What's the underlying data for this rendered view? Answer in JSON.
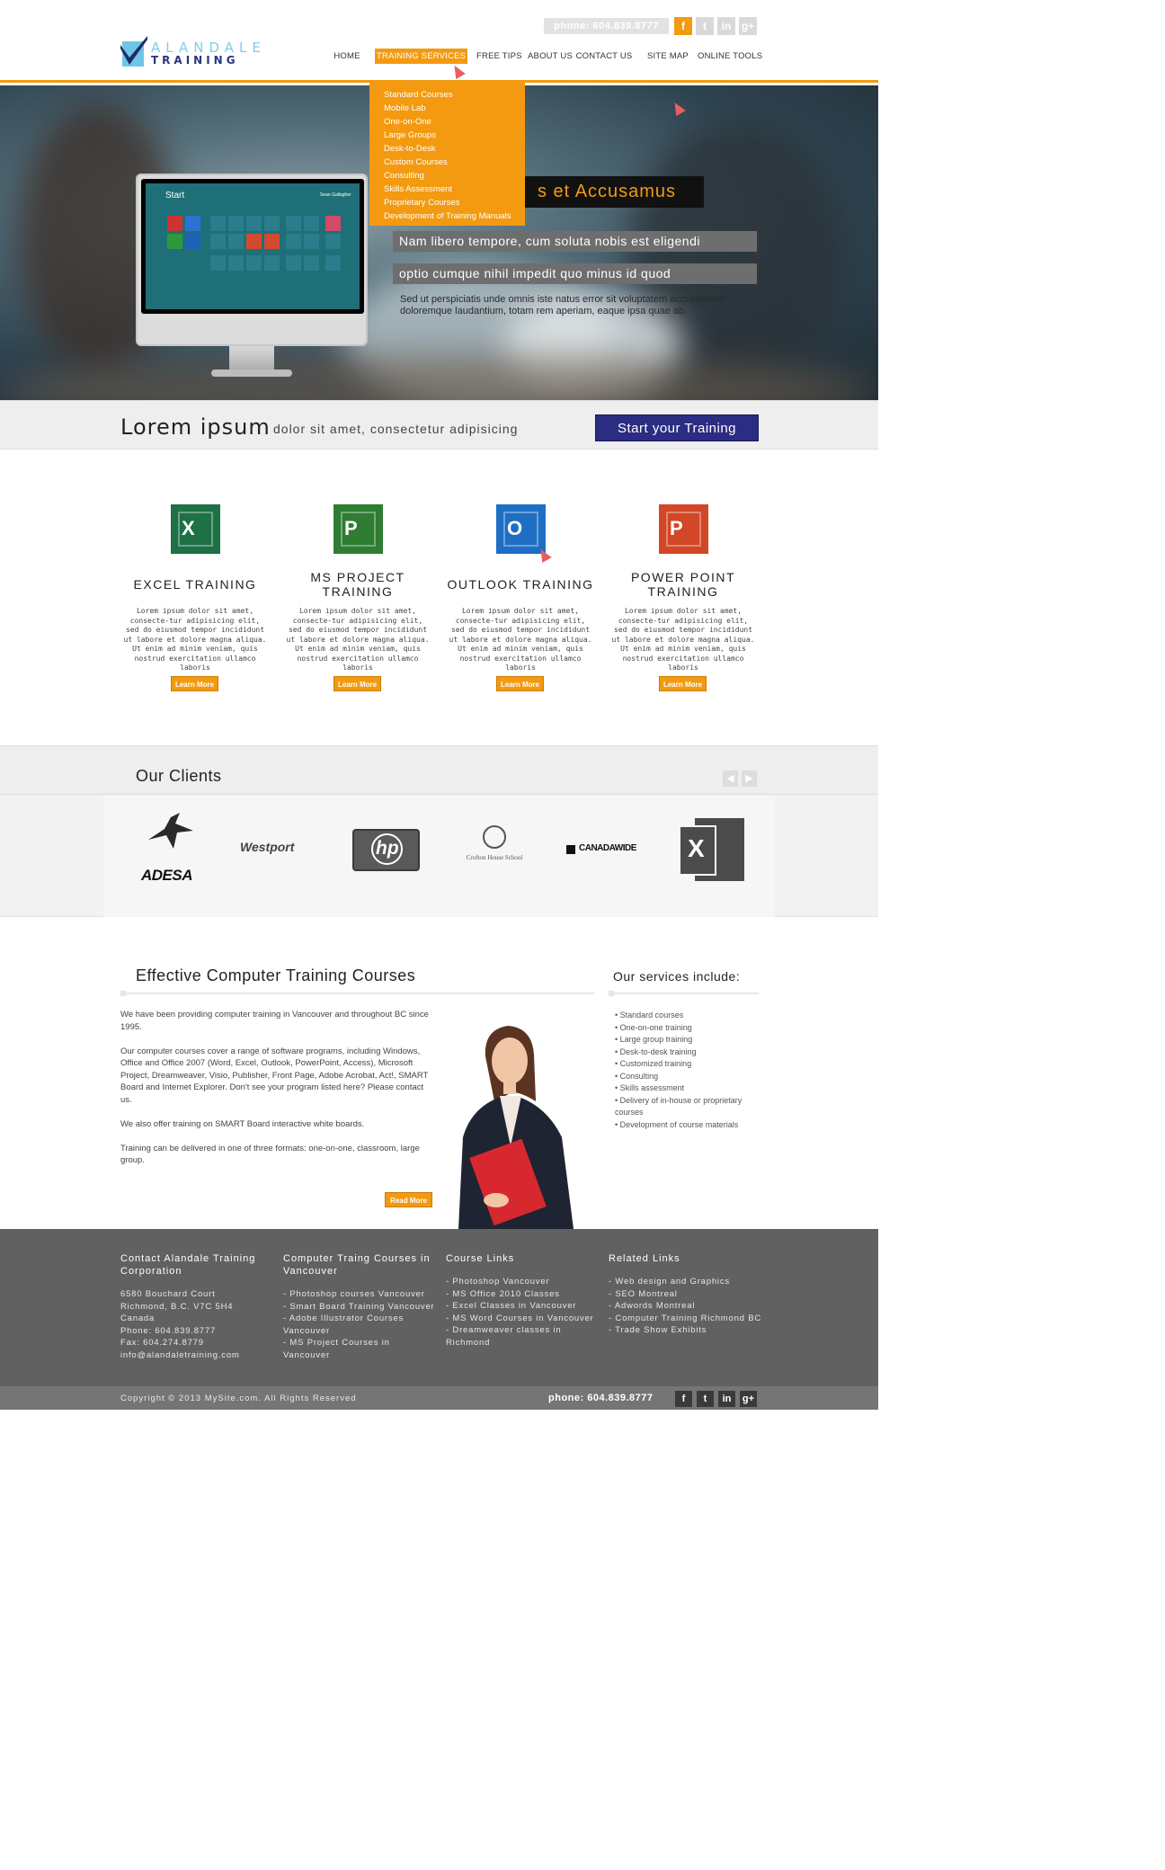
{
  "header": {
    "logo_top": "ALANDALE",
    "logo_bottom": "TRAINING",
    "phone": "phone: 604.839.8777",
    "social": [
      {
        "icon": "facebook-icon",
        "glyph": "f",
        "color": "#f39a11"
      },
      {
        "icon": "twitter-icon",
        "glyph": "t",
        "color": "#d9d9d9"
      },
      {
        "icon": "linkedin-icon",
        "glyph": "in",
        "color": "#d9d9d9"
      },
      {
        "icon": "googleplus-icon",
        "glyph": "g+",
        "color": "#d9d9d9"
      }
    ],
    "nav": [
      "HOME",
      "TRAINING SERVICES",
      "FREE TIPS",
      "ABOUT US",
      "CONTACT US",
      "SITE MAP",
      "ONLINE TOOLS"
    ],
    "dropdown": [
      "Standard Courses",
      "Mobile Lab",
      "One-on-One",
      "Large Groups",
      "Desk-to-Desk",
      "Custom Courses",
      "Consulting",
      "Skills Assessment",
      "Proprietary Courses",
      "Development of Training Manuals"
    ]
  },
  "hero": {
    "monitor_start": "Start",
    "monitor_user": "Sean Gallagher",
    "title": "s et Accusamus",
    "bar1": "Nam libero tempore, cum soluta nobis est eligendi",
    "bar2": "optio cumque nihil impedit quo minus id quod",
    "para": "Sed ut perspiciatis unde omnis iste natus error sit voluptatem accusantium doloremque laudantium, totam rem aperiam, eaque ipsa quae ab."
  },
  "cta": {
    "big": "Lorem ipsum",
    "small": "dolor sit amet, consectetur adipisicing",
    "button": "Start your Training"
  },
  "services": [
    {
      "title": "EXCEL TRAINING",
      "letter": "X",
      "color": "#1e7145",
      "text": "Lorem ipsum dolor sit amet, consecte-tur adipisicing elit, sed do eiusmod tempor incididunt ut labore et dolore magna aliqua. Ut enim ad minim veniam, quis nostrud exercitation ullamco laboris",
      "button": "Learn More"
    },
    {
      "title": "MS PROJECT TRAINING",
      "letter": "P",
      "color": "#2e7d32",
      "text": "Lorem ipsum dolor sit amet, consecte-tur adipisicing elit, sed do eiusmod tempor incididunt ut labore et dolore magna aliqua. Ut enim ad minim veniam, quis nostrud exercitation ullamco laboris",
      "button": "Learn More"
    },
    {
      "title": "OUTLOOK TRAINING",
      "letter": "O",
      "color": "#1e6fc4",
      "text": "Lorem ipsum dolor sit amet, consecte-tur adipisicing elit, sed do eiusmod tempor incididunt ut labore et dolore magna aliqua. Ut enim ad minim veniam, quis nostrud exercitation ullamco laboris",
      "button": "Learn More"
    },
    {
      "title": "POWER POINT TRAINING",
      "letter": "P",
      "color": "#d24726",
      "text": "Lorem ipsum dolor sit amet, consecte-tur adipisicing elit, sed do eiusmod tempor incididunt ut labore et dolore magna aliqua. Ut enim ad minim veniam, quis nostrud exercitation ullamco laboris",
      "button": "Learn More"
    }
  ],
  "clients": {
    "title": "Our Clients",
    "prev": "◀",
    "next": "▶",
    "logos": [
      "ADESA",
      "Westport",
      "hp",
      "Crofton House School",
      "CANADAWIDE",
      "X"
    ]
  },
  "content": {
    "title": "Effective Computer Training Courses",
    "paragraphs": [
      "We have been providing computer training in Vancouver and throughout BC since 1995.",
      "Our computer courses cover a range of software programs, including Windows, Office and Office 2007 (Word, Excel, Outlook, PowerPoint, Access), Microsoft Project, Dreamweaver, Visio, Publisher, Front Page, Adobe Acrobat, Act!, SMART Board and Internet Explorer. Don't see your program listed here? Please contact us.",
      "We also offer training on SMART Board interactive white boards.",
      "Training can be delivered in one of three formats: one-on-one, classroom, large group."
    ],
    "read_more": "Read More",
    "side_title": "Our services include:",
    "side_list": [
      "Standard courses",
      "One-on-one training",
      "Large group training",
      "Desk-to-desk training",
      "Customized training",
      "Consulting",
      "Skills assessment",
      "Delivery of in-house or proprietary courses",
      "Development of course materials"
    ]
  },
  "footer": {
    "columns": [
      {
        "heading": "Contact Alandale Training Corporation",
        "lines": [
          "6580 Bouchard Court",
          "Richmond, B.C. V7C 5H4",
          "Canada",
          "Phone: 604.839.8777",
          "Fax: 604.274.8779",
          "info@alandaletraining.com"
        ]
      },
      {
        "heading": "Computer Traing Courses in Vancouver",
        "lines": [
          "- Photoshop courses Vancouver",
          "- Smart Board Training Vancouver",
          "- Adobe Illustrator Courses Vancouver",
          "- MS Project Courses in Vancouver"
        ]
      },
      {
        "heading": "Course Links",
        "lines": [
          "- Photoshop Vancouver",
          "- MS Office 2010 Classes",
          "- Excel Classes in Vancouver",
          "- MS Word Courses in Vancouver",
          "- Dreamweaver classes in Richmond"
        ]
      },
      {
        "heading": "Related Links",
        "lines": [
          "- Web design and Graphics",
          "- SEO Montreal",
          "- Adwords Montreal",
          "- Computer Training Richmond BC",
          "- Trade Show Exhibits"
        ]
      }
    ],
    "copyright": "Copyright © 2013 MySite.com. All Rights Reserved",
    "phone": "phone: 604.839.8777"
  }
}
